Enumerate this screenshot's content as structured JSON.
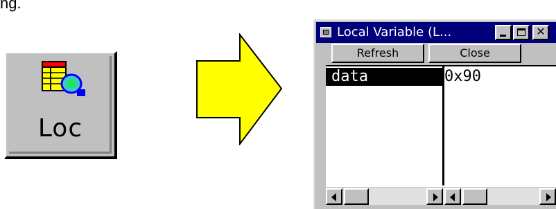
{
  "caption_fragment": "ng.",
  "loc_button": {
    "label": "Loc"
  },
  "window": {
    "title": "Local Variable (L...",
    "buttons": {
      "refresh": "Refresh",
      "close": "Close"
    },
    "variables": [
      {
        "name": "data",
        "value": "0x90"
      }
    ]
  },
  "colors": {
    "title_bar": "#00007b",
    "arrow_fill": "#ffff00",
    "face": "#c0c0c0"
  },
  "icons": [
    "local-variable-icon",
    "arrow-right-icon",
    "window-menu-icon",
    "minimize-icon",
    "maximize-icon",
    "close-icon",
    "scroll-left-icon",
    "scroll-right-icon"
  ]
}
